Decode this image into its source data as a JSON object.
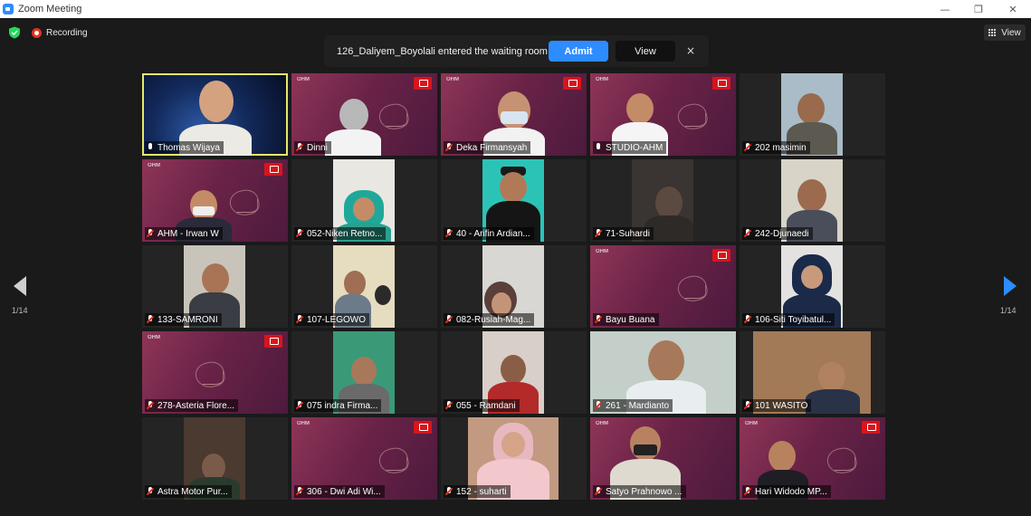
{
  "window": {
    "title": "Zoom Meeting",
    "minimize": "—",
    "maximize": "❐",
    "close": "✕"
  },
  "toolbar": {
    "recording_label": "Recording",
    "view_label": "View"
  },
  "notification": {
    "message": "126_Daliyem_Boyolali entered the waiting room",
    "admit_label": "Admit",
    "view_label": "View",
    "close_label": "×"
  },
  "pagination": {
    "left": "1/14",
    "right": "1/14"
  },
  "colors": {
    "accent": "#2d8cff",
    "recording": "#e0331f",
    "speaking_border": "#e6e86a",
    "brand": "#d9141b"
  },
  "participants": [
    {
      "name": "Thomas Wijaya",
      "muted": false,
      "speaking": true
    },
    {
      "name": "Dinni",
      "muted": true
    },
    {
      "name": "Deka Firmansyah",
      "muted": true
    },
    {
      "name": "STUDIO-AHM",
      "muted": false
    },
    {
      "name": "202 masimin",
      "muted": true
    },
    {
      "name": "AHM - Irwan W",
      "muted": true
    },
    {
      "name": "052-Niken Retno...",
      "muted": true
    },
    {
      "name": "40 - Arifin Ardian...",
      "muted": true
    },
    {
      "name": "71-Suhardi",
      "muted": true
    },
    {
      "name": "242-Djunaedi",
      "muted": true
    },
    {
      "name": "133-SAMRONI",
      "muted": true
    },
    {
      "name": "107-LEGOWO",
      "muted": true
    },
    {
      "name": "082-Rusiah-Mag...",
      "muted": true
    },
    {
      "name": "Bayu Buana",
      "muted": true
    },
    {
      "name": "106-Siti Toyibatul...",
      "muted": true
    },
    {
      "name": "278-Asteria Flore...",
      "muted": true
    },
    {
      "name": "075  indra Firma...",
      "muted": true
    },
    {
      "name": "055 - Ramdani",
      "muted": true
    },
    {
      "name": "261 - Mardianto",
      "muted": true
    },
    {
      "name": "101 WASITO",
      "muted": true
    },
    {
      "name": "Astra Motor Pur...",
      "muted": true
    },
    {
      "name": "306 - Dwi Adi Wi...",
      "muted": true
    },
    {
      "name": "152 - suharti",
      "muted": true
    },
    {
      "name": "Satyo Prahnowo ...",
      "muted": true
    },
    {
      "name": "Hari Widodo MP...",
      "muted": true
    }
  ]
}
